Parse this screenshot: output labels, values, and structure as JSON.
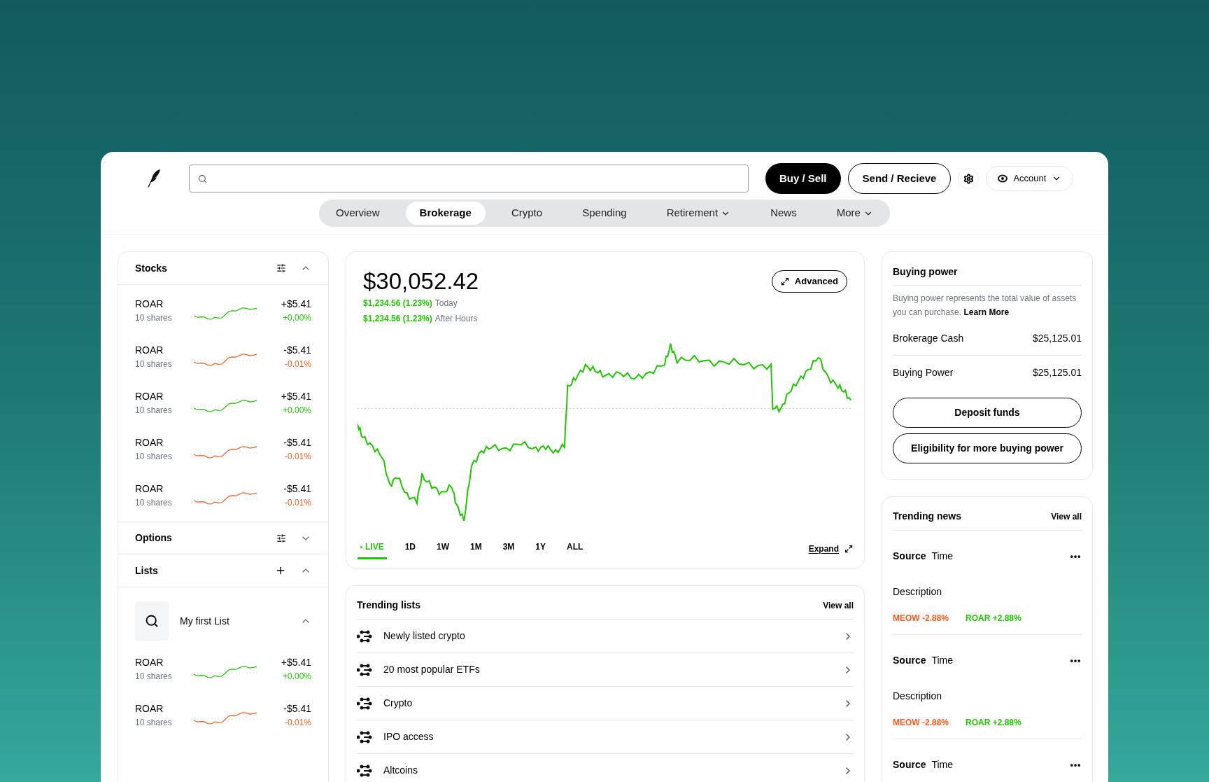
{
  "header": {
    "buttons": [
      {
        "label": "Buy / Sell",
        "kind": "primary"
      },
      {
        "label": "Send / Recieve",
        "kind": "outline"
      }
    ],
    "account": "Account"
  },
  "tabs": [
    {
      "label": "Overview",
      "selected": false,
      "has_menu": false
    },
    {
      "label": "Brokerage",
      "selected": true,
      "has_menu": false
    },
    {
      "label": "Crypto",
      "selected": false,
      "has_menu": false
    },
    {
      "label": "Spending",
      "selected": false,
      "has_menu": false
    },
    {
      "label": "Retirement",
      "selected": false,
      "has_menu": true
    },
    {
      "label": "News",
      "selected": false,
      "has_menu": false
    },
    {
      "label": "More",
      "selected": false,
      "has_menu": true
    }
  ],
  "sidebar": {
    "stocks": {
      "title": "Stocks",
      "expanded": true,
      "items": [
        {
          "symbol": "ROAR",
          "shares": "10 shares",
          "change": "+$5.41",
          "percent": "+0.00%",
          "color": "#1fc600"
        },
        {
          "symbol": "ROAR",
          "shares": "10 shares",
          "change": "-$5.41",
          "percent": "-0.01%",
          "color": "#ff5a1f"
        },
        {
          "symbol": "ROAR",
          "shares": "10 shares",
          "change": "+$5.41",
          "percent": "+0.00%",
          "color": "#1fc600"
        },
        {
          "symbol": "ROAR",
          "shares": "10 shares",
          "change": "-$5.41",
          "percent": "-0.01%",
          "color": "#ff5a1f"
        },
        {
          "symbol": "ROAR",
          "shares": "10 shares",
          "change": "-$5.41",
          "percent": "-0.01%",
          "color": "#ff5a1f"
        }
      ]
    },
    "options": {
      "title": "Options",
      "expanded": false
    },
    "lists": {
      "title": "Lists",
      "expanded": true,
      "list": {
        "name": "My first List",
        "expanded": true,
        "items": [
          {
            "symbol": "ROAR",
            "shares": "10 shares",
            "change": "+$5.41",
            "percent": "+0.00%",
            "color": "#1fc600"
          },
          {
            "symbol": "ROAR",
            "shares": "10 shares",
            "change": "-$5.41",
            "percent": "-0.01%",
            "color": "#ff5a1f"
          }
        ]
      }
    }
  },
  "portfolio": {
    "value": "$30,052.42",
    "changes": [
      {
        "amount": "$1,234.56 (1.23%)",
        "label": "Today"
      },
      {
        "amount": "$1,234.56 (1.23%)",
        "label": "After Hours"
      }
    ],
    "advanced": "Advanced",
    "ranges": [
      {
        "label": "LIVE",
        "selected": true
      },
      {
        "label": "1D",
        "selected": false
      },
      {
        "label": "1W",
        "selected": false
      },
      {
        "label": "1M",
        "selected": false
      },
      {
        "label": "3M",
        "selected": false
      },
      {
        "label": "1Y",
        "selected": false
      },
      {
        "label": "ALL",
        "selected": false
      }
    ],
    "expand": "Expand"
  },
  "trending_lists": {
    "title": "Trending lists",
    "view_all": "View all",
    "items": [
      "Newly listed crypto",
      "20 most popular ETFs",
      "Crypto",
      "IPO access",
      "Altcoins"
    ]
  },
  "buying_power": {
    "title": "Buying power",
    "description": "Buying power represents the total value of assets you can purchase.",
    "link": "Learn More",
    "rows": [
      {
        "label": "Brokerage Cash",
        "value": "$25,125.01"
      },
      {
        "label": "Buying Power",
        "value": "$25,125.01"
      }
    ],
    "buttons": [
      "Deposit funds",
      "Eligibility for more buying power"
    ]
  },
  "trending_news": {
    "title": "Trending news",
    "view_all": "View all",
    "items": [
      {
        "source": "Source",
        "time": "Time",
        "description": "Description",
        "tickers": [
          {
            "text": "MEOW -2.88%",
            "color": "#ff5a1f"
          },
          {
            "text": "ROAR +2.88%",
            "color": "#1fc600"
          }
        ]
      },
      {
        "source": "Source",
        "time": "Time",
        "description": "Description",
        "tickers": [
          {
            "text": "MEOW -2.88%",
            "color": "#ff5a1f"
          },
          {
            "text": "ROAR +2.88%",
            "color": "#1fc600"
          }
        ]
      },
      {
        "source": "Source",
        "time": "Time"
      }
    ]
  }
}
